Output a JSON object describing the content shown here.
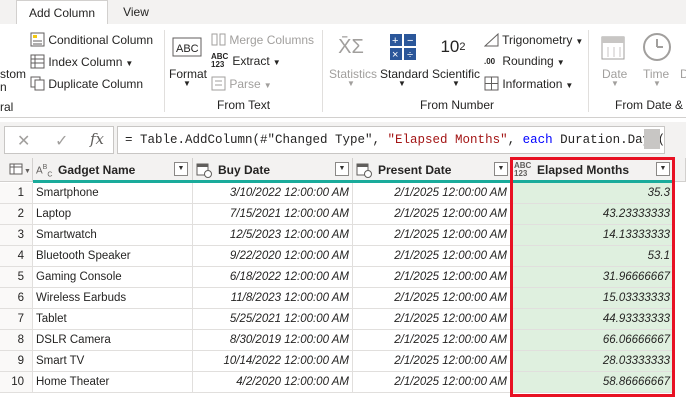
{
  "tabs": [
    "Add Column",
    "View"
  ],
  "ribbon": {
    "general_fragment_top": "stom",
    "general_fragment_bottom": "n",
    "general_label_fragment": "ral",
    "conditional_column": "Conditional Column",
    "index_column": "Index Column",
    "duplicate_column": "Duplicate Column",
    "format": "Format",
    "merge_columns": "Merge Columns",
    "extract": "Extract",
    "parse": "Parse",
    "from_text": "From Text",
    "statistics": "Statistics",
    "standard": "Standard",
    "scientific": "Scientific",
    "trigonometry": "Trigonometry",
    "rounding": "Rounding",
    "information": "Information",
    "from_number": "From Number",
    "date": "Date",
    "time": "Time",
    "from_date_time": "From Date & T",
    "scientific_icon": "10",
    "scientific_exp": "2"
  },
  "formula": {
    "cancel": "✕",
    "commit": "✓",
    "fx": "fx",
    "prefix": "= Table.AddColumn(#\"Changed Type\", ",
    "string": "\"Elapsed Months\"",
    "mid": ", ",
    "keyword": "each",
    "suffix": " Duration.Days("
  },
  "columns": [
    {
      "name": "Gadget Name",
      "type_icon": "A B C"
    },
    {
      "name": "Buy Date",
      "type_icon": "date-time"
    },
    {
      "name": "Present Date",
      "type_icon": "date-time"
    },
    {
      "name": "Elapsed Months",
      "type_icon": "ABC 123"
    }
  ],
  "rows": [
    {
      "n": "1",
      "name": "Smartphone",
      "buy": "3/10/2022 12:00:00 AM",
      "present": "2/1/2025 12:00:00 AM",
      "elapsed": "35.3"
    },
    {
      "n": "2",
      "name": "Laptop",
      "buy": "7/15/2021 12:00:00 AM",
      "present": "2/1/2025 12:00:00 AM",
      "elapsed": "43.23333333"
    },
    {
      "n": "3",
      "name": "Smartwatch",
      "buy": "12/5/2023 12:00:00 AM",
      "present": "2/1/2025 12:00:00 AM",
      "elapsed": "14.13333333"
    },
    {
      "n": "4",
      "name": "Bluetooth Speaker",
      "buy": "9/22/2020 12:00:00 AM",
      "present": "2/1/2025 12:00:00 AM",
      "elapsed": "53.1"
    },
    {
      "n": "5",
      "name": "Gaming Console",
      "buy": "6/18/2022 12:00:00 AM",
      "present": "2/1/2025 12:00:00 AM",
      "elapsed": "31.96666667"
    },
    {
      "n": "6",
      "name": "Wireless Earbuds",
      "buy": "11/8/2023 12:00:00 AM",
      "present": "2/1/2025 12:00:00 AM",
      "elapsed": "15.03333333"
    },
    {
      "n": "7",
      "name": "Tablet",
      "buy": "5/25/2021 12:00:00 AM",
      "present": "2/1/2025 12:00:00 AM",
      "elapsed": "44.93333333"
    },
    {
      "n": "8",
      "name": "DSLR Camera",
      "buy": "8/30/2019 12:00:00 AM",
      "present": "2/1/2025 12:00:00 AM",
      "elapsed": "66.06666667"
    },
    {
      "n": "9",
      "name": "Smart TV",
      "buy": "10/14/2022 12:00:00 AM",
      "present": "2/1/2025 12:00:00 AM",
      "elapsed": "28.03333333"
    },
    {
      "n": "10",
      "name": "Home Theater",
      "buy": "4/2/2020 12:00:00 AM",
      "present": "2/1/2025 12:00:00 AM",
      "elapsed": "58.86666667"
    }
  ],
  "colors": {
    "accent_teal": "#1aab9b",
    "highlight_red": "#e81123",
    "new_column_fill": "#dff0df"
  }
}
